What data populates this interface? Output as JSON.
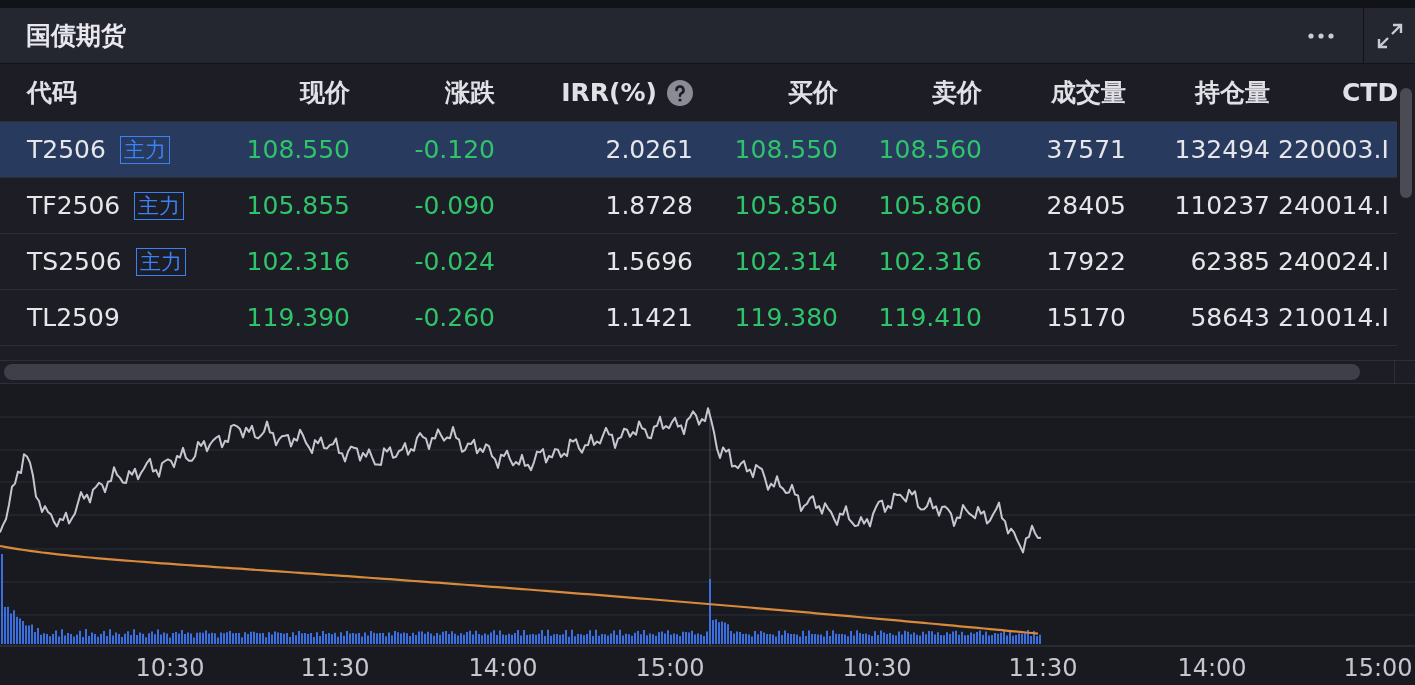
{
  "panel": {
    "title": "国债期货"
  },
  "table": {
    "columns": [
      {
        "label": "代码",
        "help": false
      },
      {
        "label": "现价",
        "help": false
      },
      {
        "label": "涨跌",
        "help": false
      },
      {
        "label": "IRR(%)",
        "help": true
      },
      {
        "label": "买价",
        "help": false
      },
      {
        "label": "卖价",
        "help": false
      },
      {
        "label": "成交量",
        "help": false
      },
      {
        "label": "持仓量",
        "help": false
      },
      {
        "label": "CTD",
        "help": false
      }
    ],
    "rows": [
      {
        "code": "T2506",
        "tag": "主力",
        "selected": true,
        "price": "108.550",
        "change": "-0.120",
        "irr": "2.0261",
        "bid": "108.550",
        "ask": "108.560",
        "volume": "37571",
        "open_interest": "132494",
        "ctd": "220003.I"
      },
      {
        "code": "TF2506",
        "tag": "主力",
        "selected": false,
        "price": "105.855",
        "change": "-0.090",
        "irr": "1.8728",
        "bid": "105.850",
        "ask": "105.860",
        "volume": "28405",
        "open_interest": "110237",
        "ctd": "240014.I"
      },
      {
        "code": "TS2506",
        "tag": "主力",
        "selected": false,
        "price": "102.316",
        "change": "-0.024",
        "irr": "1.5696",
        "bid": "102.314",
        "ask": "102.316",
        "volume": "17922",
        "open_interest": "62385",
        "ctd": "240024.I"
      },
      {
        "code": "TL2509",
        "selected": false,
        "price": "119.390",
        "change": "-0.260",
        "irr": "1.1421",
        "bid": "119.380",
        "ask": "119.410",
        "volume": "15170",
        "open_interest": "58643",
        "ctd": "210014.I"
      }
    ]
  },
  "chart": {
    "time_labels": [
      "10:30",
      "11:30",
      "14:00",
      "15:00",
      "10:30",
      "11:30",
      "14:00",
      "15:00"
    ]
  }
}
